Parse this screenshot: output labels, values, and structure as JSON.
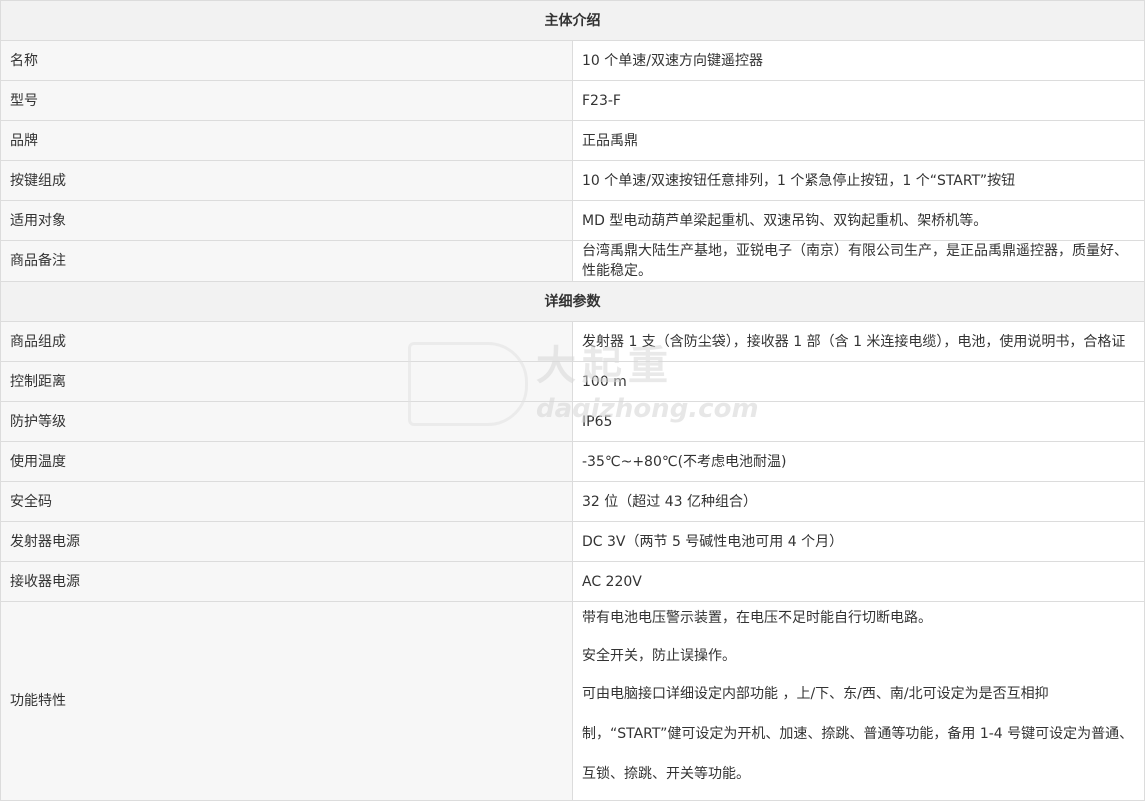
{
  "section_intro": "主体介绍",
  "intro_rows": [
    {
      "label": "名称",
      "value": "10 个单速/双速方向键遥控器"
    },
    {
      "label": "型号",
      "value": "F23-F"
    },
    {
      "label": "品牌",
      "value": "正品禹鼎"
    },
    {
      "label": "按键组成",
      "value": "10 个单速/双速按钮任意排列，1 个紧急停止按钮，1 个“START”按钮"
    },
    {
      "label": "适用对象",
      "value": "MD 型电动葫芦单梁起重机、双速吊钩、双钩起重机、架桥机等。"
    },
    {
      "label": "商品备注",
      "value": "台湾禹鼎大陆生产基地，亚锐电子（南京）有限公司生产，是正品禹鼎遥控器，质量好、性能稳定。"
    }
  ],
  "section_detail": "详细参数",
  "detail_rows": [
    {
      "label": "商品组成",
      "value": "发射器 1 支（含防尘袋），接收器 1 部（含 1 米连接电缆），电池，使用说明书，合格证"
    },
    {
      "label": "控制距离",
      "value": "100 m"
    },
    {
      "label": "防护等级",
      "value": "IP65"
    },
    {
      "label": "使用温度",
      "value": "-35℃~+80℃(不考虑电池耐温)"
    },
    {
      "label": "安全码",
      "value": "32 位（超过 43 亿种组合）"
    },
    {
      "label": "发射器电源",
      "value": "DC 3V（两节 5 号碱性电池可用 4 个月）"
    },
    {
      "label": "接收器电源",
      "value": "AC 220V"
    }
  ],
  "features": {
    "label": "功能特性",
    "lines": [
      "带有电池电压警示装置，在电压不足时能自行切断电路。",
      "安全开关，防止误操作。",
      "可由电脑接口详细设定内部功能 ，上/下、东/西、南/北可设定为是否互相抑制，“START”健可设定为开机、加速、捺跳、普通等功能，备用 1-4 号键可设定为普通、互锁、捺跳、开关等功能。"
    ]
  },
  "watermark": {
    "cn": "大起重",
    "en": "daqizhong.com"
  }
}
